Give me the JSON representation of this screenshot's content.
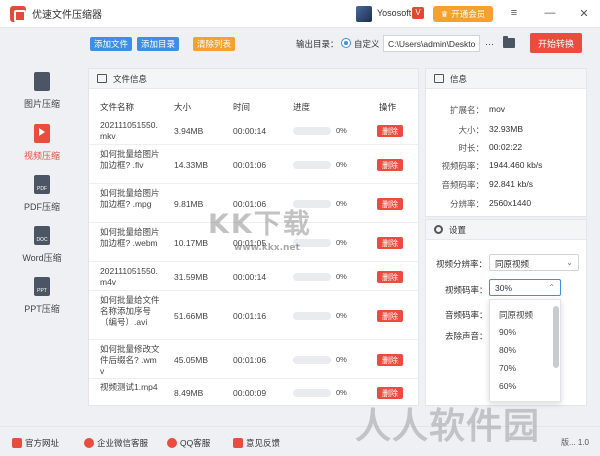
{
  "app": {
    "title": "优速文件压缩器",
    "user_name": "Yososoft",
    "vip_badge": "V",
    "member_label": "开通会员",
    "menu_glyph": "≡",
    "minimize_glyph": "—",
    "close_glyph": "✕"
  },
  "toolbar": {
    "add_file": "添加文件",
    "add_folder": "添加目录",
    "clear_list": "清除列表",
    "output_label": "输出目录：",
    "custom_label": "自定义",
    "output_path": "C:\\Users\\admin\\Deskto",
    "more": "···",
    "start": "开始转换"
  },
  "sidebar": {
    "items": [
      {
        "label": "图片压缩",
        "icon_text": ""
      },
      {
        "label": "视频压缩",
        "icon_text": ""
      },
      {
        "label": "PDF压缩",
        "icon_text": "PDF"
      },
      {
        "label": "Word压缩",
        "icon_text": "DOC"
      },
      {
        "label": "PPT压缩",
        "icon_text": "PPT"
      }
    ]
  },
  "file_panel": {
    "title": "文件信息",
    "columns": [
      "文件名称",
      "大小",
      "时间",
      "进度",
      "操作"
    ],
    "delete_label": "删除",
    "rows": [
      {
        "name": "202111051550.mkv",
        "size": "3.94MB",
        "time": "00:00:14",
        "progress": "0%"
      },
      {
        "name": "如何批量给图片加边框? .flv",
        "size": "14.33MB",
        "time": "00:01:06",
        "progress": "0%"
      },
      {
        "name": "如何批量给图片加边框? .mpg",
        "size": "9.81MB",
        "time": "00:01:06",
        "progress": "0%"
      },
      {
        "name": "如何批量给图片加边框? .webm",
        "size": "10.17MB",
        "time": "00:01:05",
        "progress": "0%"
      },
      {
        "name": "202111051550.m4v",
        "size": "31.59MB",
        "time": "00:00:14",
        "progress": "0%"
      },
      {
        "name": "如何批量给文件名称添加序号（编号）.avi",
        "size": "51.66MB",
        "time": "00:01:16",
        "progress": "0%"
      },
      {
        "name": "如何批量修改文件后缀名? .wmv",
        "size": "45.05MB",
        "time": "00:01:06",
        "progress": "0%"
      },
      {
        "name": "视频测试1.mp4",
        "size": "8.49MB",
        "time": "00:00:09",
        "progress": "0%"
      }
    ]
  },
  "info_panel": {
    "title": "信息",
    "rows": [
      {
        "key": "扩展名：",
        "value": "mov"
      },
      {
        "key": "大小：",
        "value": "32.93MB"
      },
      {
        "key": "时长：",
        "value": "00:02:22"
      },
      {
        "key": "视频码率：",
        "value": "1944.460 kb/s"
      },
      {
        "key": "音频码率：",
        "value": "92.841 kb/s"
      },
      {
        "key": "分辨率：",
        "value": "2560x1440"
      }
    ]
  },
  "settings": {
    "title": "设置",
    "resolution_label": "视频分辨率：",
    "resolution_value": "同原视频",
    "bitrate_label": "视频码率：",
    "bitrate_value": "30%",
    "audio_label": "音频码率：",
    "mute_label": "去除声音：",
    "options": [
      "同原视频",
      "90%",
      "80%",
      "70%",
      "60%"
    ]
  },
  "footer": {
    "items": [
      "官方网址",
      "企业微信客服",
      "QQ客服",
      "意见反馈"
    ],
    "version": "版... 1.0"
  },
  "watermark": {
    "center": "KK下载",
    "url": "www.kkx.net",
    "corner": "人人软件园"
  },
  "colors": {
    "accent_red": "#ea4d3d",
    "accent_blue": "#3e8ee8",
    "accent_orange": "#f5a12d"
  }
}
